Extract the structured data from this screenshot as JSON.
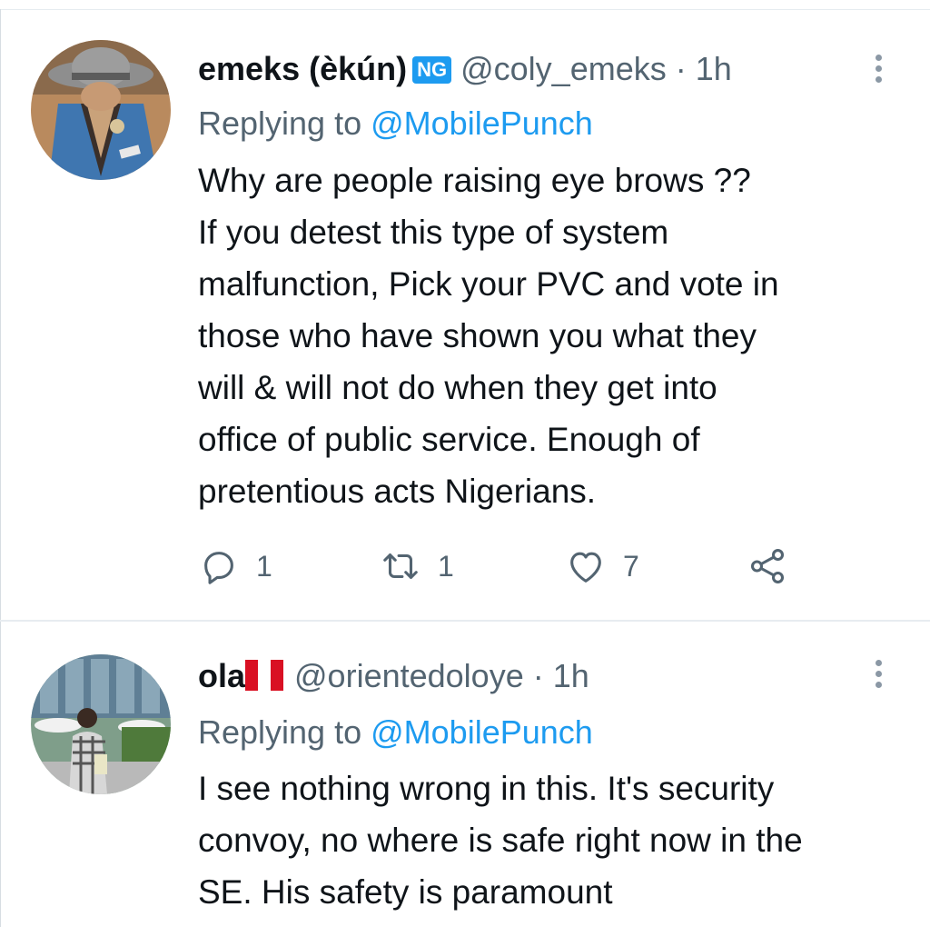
{
  "tweets": [
    {
      "display_name": "emeks (èkún)",
      "flag_badge": "NG",
      "handle": "@coly_emeks",
      "separator": "·",
      "time": "1h",
      "replying_prefix": "Replying to",
      "replying_to": "@MobilePunch",
      "text_lines": [
        "Why are people raising eye brows ??",
        "If you detest this type of system",
        "malfunction, Pick your PVC and vote in",
        "those who have shown you what they",
        "will & will not do when they get into",
        "office of public service. Enough of",
        "pretentious acts Nigerians."
      ],
      "reply_count": "1",
      "retweet_count": "1",
      "like_count": "7"
    },
    {
      "display_name": "ola",
      "flag_icon": "peru-flag-icon",
      "handle": "@orientedoloye",
      "separator": "·",
      "time": "1h",
      "replying_prefix": "Replying to",
      "replying_to": "@MobilePunch",
      "text_lines": [
        "I see nothing wrong in this. It's security",
        "convoy, no where is safe right now in the",
        "SE. His safety is paramount"
      ]
    }
  ],
  "colors": {
    "link": "#1d9bf0",
    "secondary_text": "#536471",
    "primary_text": "#0f1419",
    "flag_red": "#d91023"
  }
}
